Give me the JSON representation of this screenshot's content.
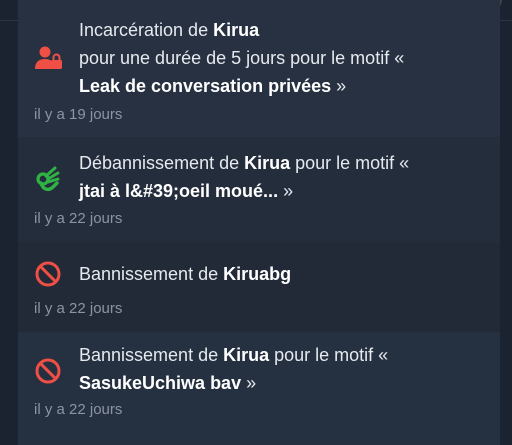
{
  "feed": {
    "items": [
      {
        "icon": "user-lock-icon",
        "line1_prefix": "Incarcération de ",
        "user": "Kirua",
        "line2": "pour une durée de 5 jours pour le motif «",
        "reason": "Leak de conversation privées",
        "close": " »",
        "time": "il y a 19 jours"
      },
      {
        "icon": "ok-hand-icon",
        "line1_prefix": "Débannissement de ",
        "user": "Kirua",
        "line1_suffix": " pour le motif «",
        "reason": "jtai à l&#39;oeil moué...",
        "close": " »",
        "time": "il y a 22 jours"
      },
      {
        "icon": "ban-icon",
        "line1_prefix": "Bannissement de ",
        "user": "Kiruabg",
        "time": "il y a 22 jours"
      },
      {
        "icon": "ban-icon",
        "line1_prefix": "Bannissement de ",
        "user": "Kirua",
        "line1_suffix": " pour le motif «",
        "reason": "SasukeUchiwa bav",
        "close": " »",
        "time": "il y a 22 jours"
      }
    ]
  },
  "colors": {
    "danger": "#f04f45",
    "success": "#2fb344"
  }
}
